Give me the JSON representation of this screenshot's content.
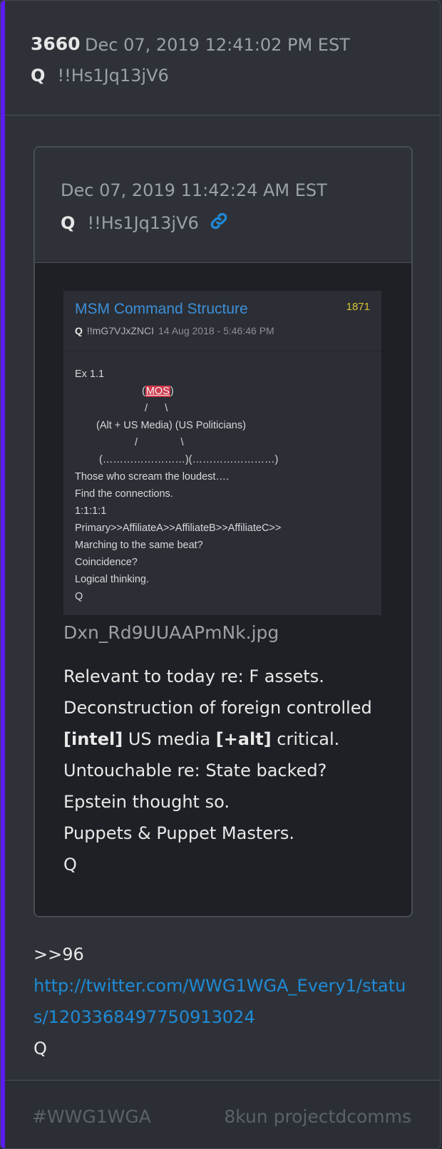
{
  "post": {
    "number": "3660",
    "date": "Dec 07, 2019 12:41:02 PM EST",
    "author": "Q",
    "tripcode": "!!Hs1Jq13jV6"
  },
  "quoted": {
    "date": "Dec 07, 2019 11:42:24 AM EST",
    "author": "Q",
    "tripcode": "!!Hs1Jq13jV6",
    "link_icon": "link-icon",
    "image": {
      "title": "MSM Command Structure",
      "number": "1871",
      "author": "Q",
      "tripcode": "!!mG7VJxZNCI",
      "date": "14 Aug 2018 - 5:46:46 PM",
      "lines": [
        "Ex 1.1",
        "(",
        "MOS",
        ")",
        "/      \\",
        "(Alt + US Media) (US Politicians)",
        "/               \\",
        "(……………………)(……………………)",
        "Those who scream the loudest….",
        "Find the connections.",
        "1:1:1:1",
        "Primary>>AffiliateA>>AffiliateB>>AffiliateC>>",
        "Marching to the same beat?",
        "Coincidence?",
        "Logical thinking.",
        "Q"
      ]
    },
    "filename": "Dxn_Rd9UUAAPmNk.jpg",
    "text": {
      "l1": "Relevant to today re: F assets.",
      "l2": "Deconstruction of foreign controlled",
      "l3_b1": "[intel]",
      "l3_t1": " US media ",
      "l3_b2": "[+alt]",
      "l3_t2": " critical.",
      "l4": "Untouchable re: State backed?",
      "l5": "Epstein thought so.",
      "l6": "Puppets & Puppet Masters.",
      "l7": "Q"
    }
  },
  "body": {
    "ref": ">>96",
    "link_line1": "http://twitter.com/WWG1WGA_Every1/statu",
    "link_line2": "s/1203368497750913024",
    "sign": "Q"
  },
  "footer": {
    "tag": "#WWG1WGA",
    "board": "8kun projectdcomms"
  },
  "colors": {
    "accent": "#5a1cf0",
    "link": "#1f8ad6",
    "highlight": "#d0394c",
    "number": "#d8c234"
  }
}
